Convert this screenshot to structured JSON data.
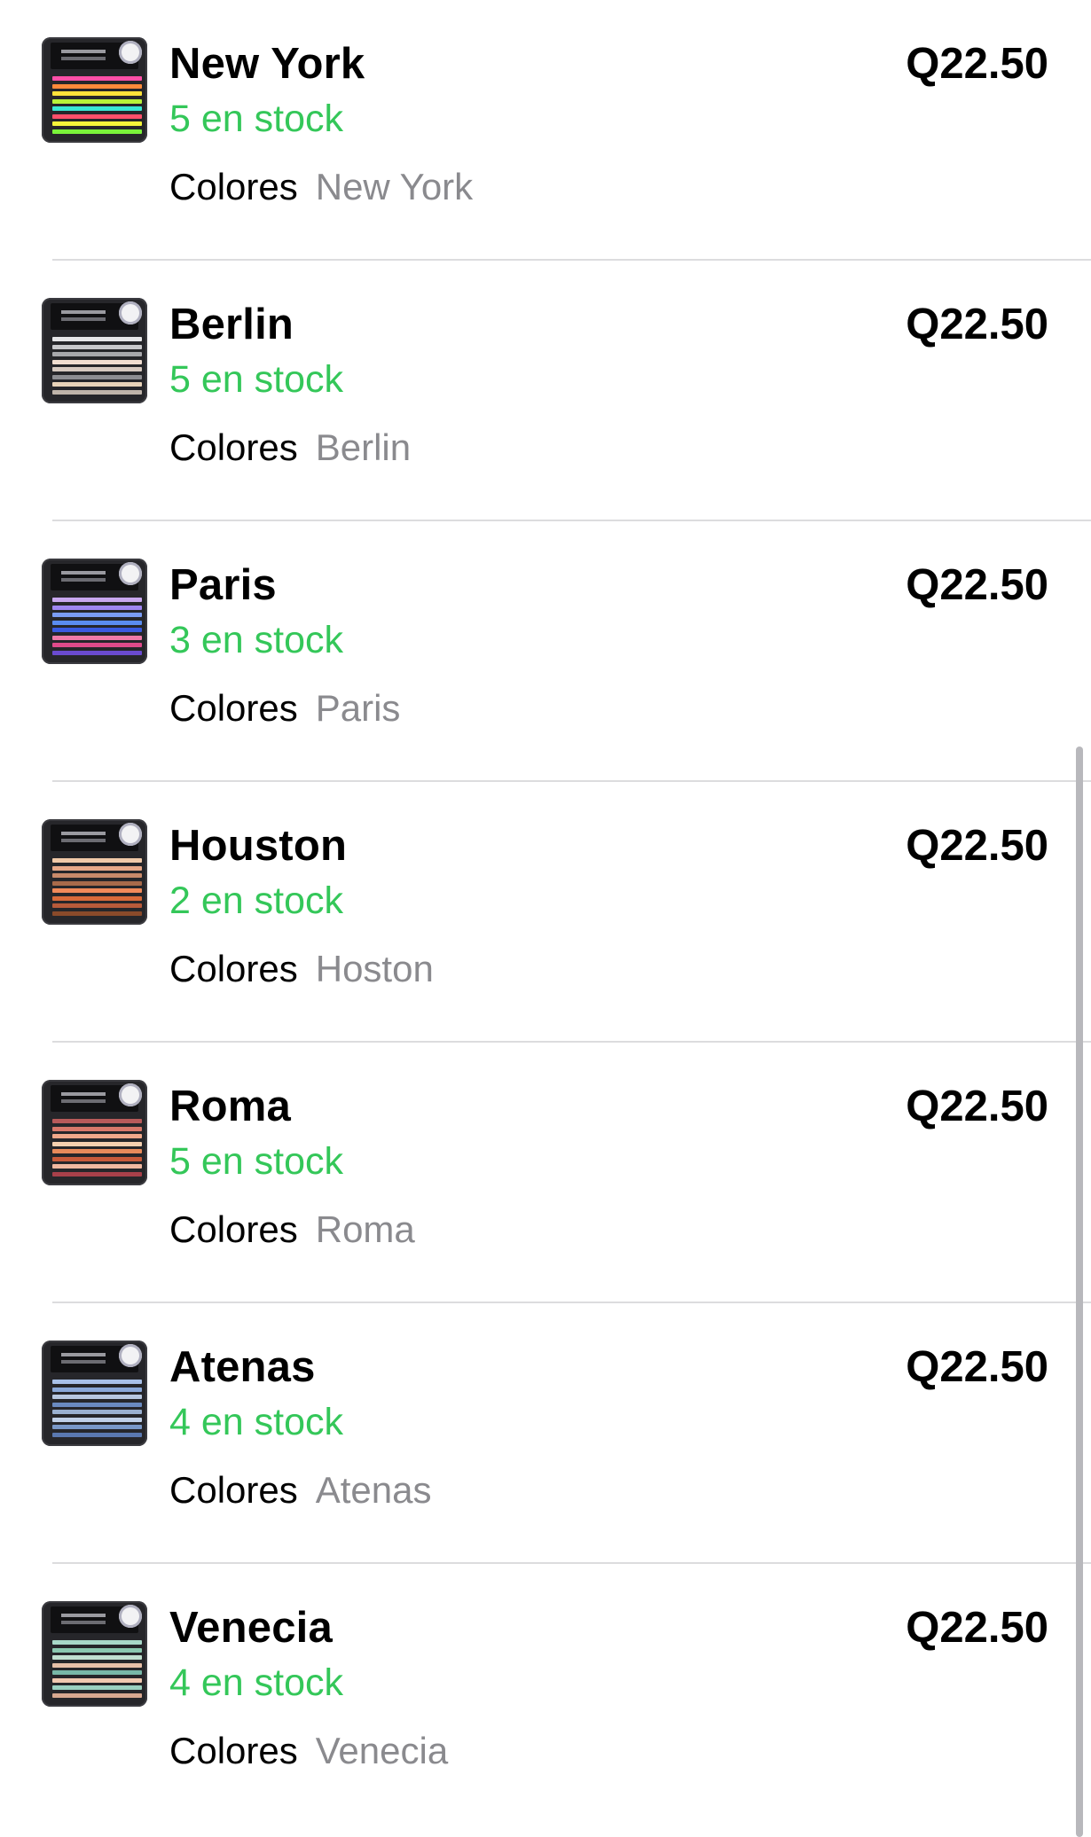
{
  "items": [
    {
      "name": "New York",
      "stock": "5 en stock",
      "price": "Q22.50",
      "option_label": "Colores",
      "option_value": "New York",
      "thumbnail_colors": [
        "#ff4fa8",
        "#ff8a3a",
        "#ffe23a",
        "#b8f23a",
        "#3ae8d6",
        "#ff4f6a",
        "#f5f53a",
        "#7af23a"
      ]
    },
    {
      "name": "Berlin",
      "stock": "5 en stock",
      "price": "Q22.50",
      "option_label": "Colores",
      "option_value": "Berlin",
      "thumbnail_colors": [
        "#e6e6e8",
        "#c9c9cc",
        "#a8a8ac",
        "#f0ddd0",
        "#d6c9c0",
        "#8d8d92",
        "#e8d2b8",
        "#bfb4aa"
      ]
    },
    {
      "name": "Paris",
      "stock": "3 en stock",
      "price": "Q22.50",
      "option_label": "Colores",
      "option_value": "Paris",
      "thumbnail_colors": [
        "#c9a8f0",
        "#9f86f2",
        "#7a9cf5",
        "#5a8cf0",
        "#3a5ae0",
        "#f07aa8",
        "#e04a8a",
        "#6a4ad0"
      ]
    },
    {
      "name": "Houston",
      "stock": "2 en stock",
      "price": "Q22.50",
      "option_label": "Colores",
      "option_value": "Hoston",
      "thumbnail_colors": [
        "#f0c9a8",
        "#e8a888",
        "#c98a6a",
        "#a86a4a",
        "#f08a5a",
        "#d86a3a",
        "#b85a3a",
        "#8a4a2a"
      ]
    },
    {
      "name": "Roma",
      "stock": "5 en stock",
      "price": "Q22.50",
      "option_label": "Colores",
      "option_value": "Roma",
      "thumbnail_colors": [
        "#b85a5a",
        "#d8786a",
        "#f0a88a",
        "#f5d0b0",
        "#e88a5a",
        "#c85a3a",
        "#f0b8a0",
        "#a8404a"
      ]
    },
    {
      "name": "Atenas",
      "stock": "4 en stock",
      "price": "Q22.50",
      "option_label": "Colores",
      "option_value": "Atenas",
      "thumbnail_colors": [
        "#a8c0e8",
        "#8aa8d8",
        "#b8c8e0",
        "#6a8ac0",
        "#9ab0d0",
        "#c0d0e8",
        "#7a98c8",
        "#5a78b0"
      ]
    },
    {
      "name": "Venecia",
      "stock": "4 en stock",
      "price": "Q22.50",
      "option_label": "Colores",
      "option_value": "Venecia",
      "thumbnail_colors": [
        "#a8d8c8",
        "#8ac8b0",
        "#c0e0d0",
        "#e8c0a8",
        "#78b8a8",
        "#f0c8b0",
        "#9ad0c0",
        "#d8a890"
      ]
    }
  ],
  "colors": {
    "stock_green": "#34c759",
    "secondary_gray": "#8a8a8e",
    "separator": "#dcdcde"
  }
}
